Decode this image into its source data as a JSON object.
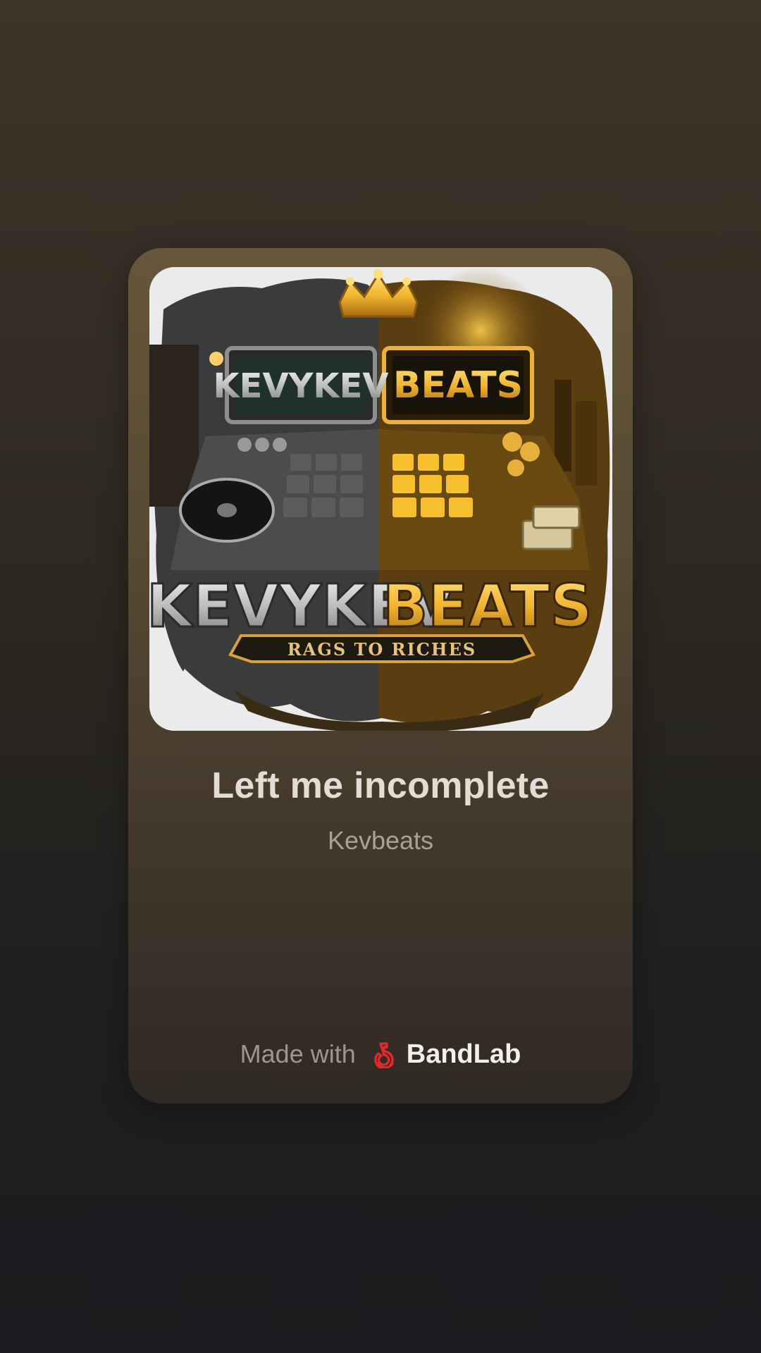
{
  "player": {
    "cover_art": "KevyKev Beats logo artwork",
    "cover_art_text": {
      "screen_left": "KEVYKEV",
      "screen_right": "BEATS",
      "logo_left": "KEVYKEV",
      "logo_right": "BEATS",
      "tagline": "RAGS TO RICHES"
    },
    "track_title": "Left me incomplete",
    "artist": "Kevbeats"
  },
  "footer": {
    "made_with": "Made with",
    "brand": "BandLab",
    "brand_icon": "bandlab-logo-icon",
    "brand_color": "#e0282e"
  },
  "colors": {
    "gold": "#f2b531",
    "silver": "#c9c9c9"
  }
}
